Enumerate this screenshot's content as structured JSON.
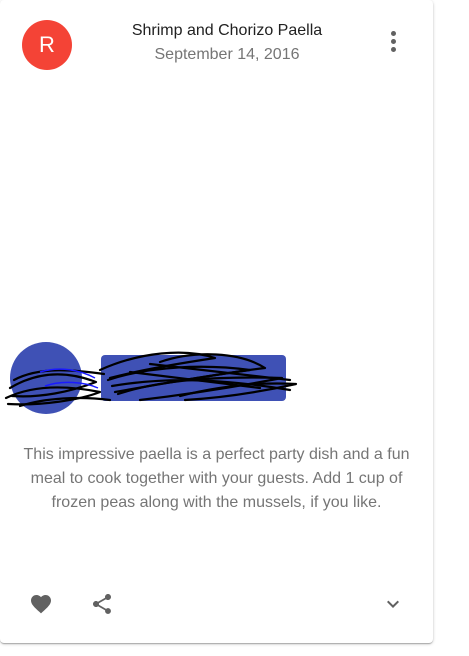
{
  "card": {
    "avatar_letter": "R",
    "title": "Shrimp and Chorizo Paella",
    "subheader": "September 14, 2016",
    "description": "This impressive paella is a perfect party dish and a fun meal to cook together with your guests. Add 1 cup of frozen peas along with the mussels, if you like."
  },
  "icons": {
    "more": "more-vert-icon",
    "favorite": "heart-icon",
    "share": "share-icon",
    "expand": "chevron-down-icon"
  },
  "colors": {
    "avatar": "#f44336",
    "accent": "#3f51b5",
    "scribble": "#000000"
  }
}
